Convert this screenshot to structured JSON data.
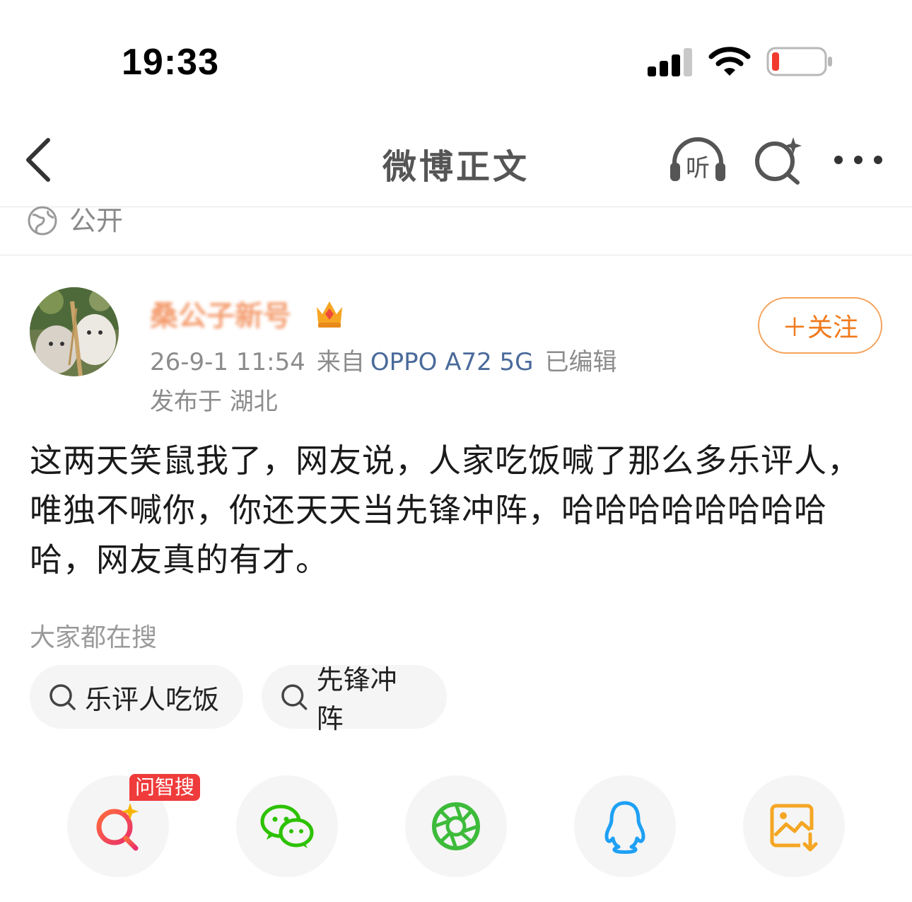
{
  "status_bar": {
    "time": "19:33",
    "battery_color": "#f23b2f"
  },
  "nav": {
    "title": "微博正文",
    "listen_label": "听"
  },
  "visibility": {
    "label": "公开"
  },
  "author": {
    "name": "桑公子新号",
    "timestamp": "26-9-1 11:54",
    "source_prefix": "来自",
    "device": "OPPO A72 5G",
    "edited": "已编辑",
    "location": "发布于 湖北",
    "follow_label": "＋关注"
  },
  "post": {
    "text": "这两天笑鼠我了，网友说，人家吃饭喊了那么多乐评人，唯独不喊你，你还天天当先锋冲阵，哈哈哈哈哈哈哈哈哈，网友真的有才。"
  },
  "hot_search": {
    "label": "大家都在搜",
    "items": [
      "乐评人吃饭",
      "先锋冲阵"
    ]
  },
  "share": {
    "badge": "问智搜",
    "items": [
      "ask-search",
      "wechat",
      "moments",
      "qq",
      "save-image"
    ]
  },
  "colors": {
    "accent": "#f07a1c",
    "link": "#4a6a9a",
    "wechat": "#2dc100",
    "qq": "#1ea0f5",
    "save": "#f5a623"
  }
}
